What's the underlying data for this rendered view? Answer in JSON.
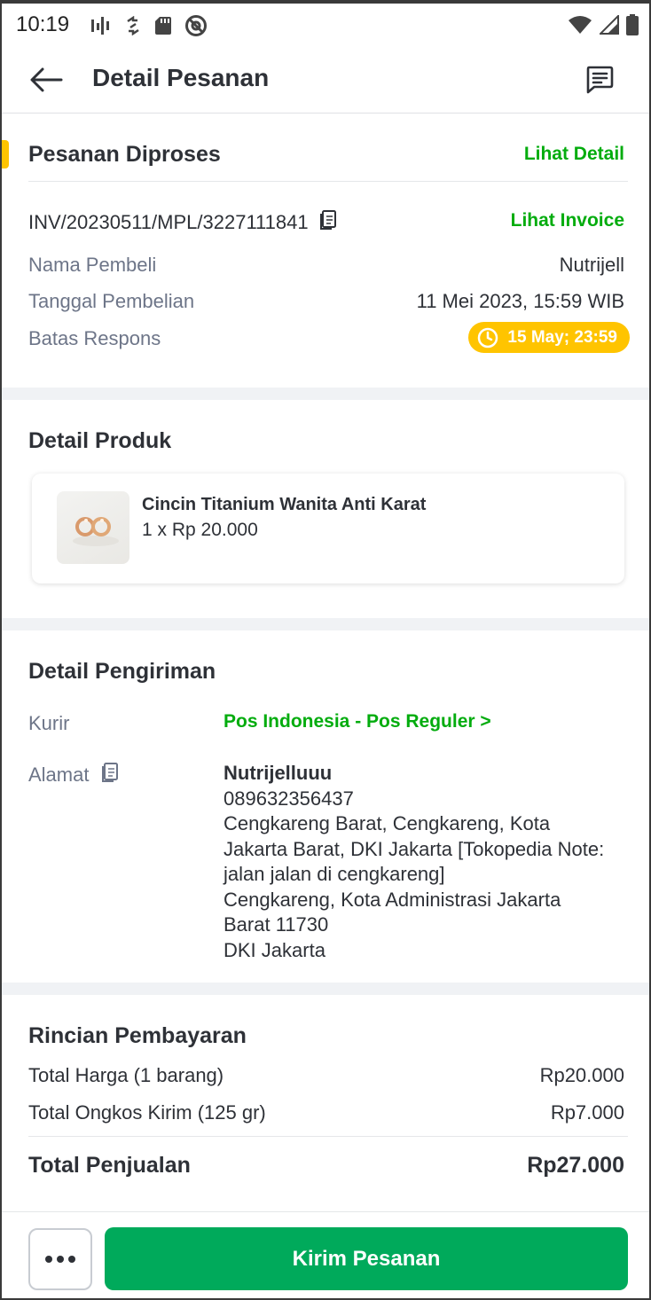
{
  "status_bar": {
    "time": "10:19"
  },
  "header": {
    "title": "Detail Pesanan",
    "back_icon": "arrow-left-icon",
    "chat_icon": "chat-list-icon"
  },
  "order_status": {
    "title": "Pesanan Diproses",
    "detail_link": "Lihat Detail",
    "invoice_number": "INV/20230511/MPL/3227111841",
    "invoice_link": "Lihat Invoice",
    "rows": [
      {
        "label": "Nama Pembeli",
        "value": "Nutrijell"
      },
      {
        "label": "Tanggal Pembelian",
        "value": "11 Mei 2023, 15:59 WIB"
      },
      {
        "label": "Batas Respons",
        "value": "15 May; 23:59"
      }
    ]
  },
  "product_section": {
    "title": "Detail Produk",
    "product": {
      "name": "Cincin Titanium Wanita Anti Karat",
      "quantity_price": "1 x Rp 20.000"
    }
  },
  "shipping_section": {
    "title": "Detail Pengiriman",
    "courier_label": "Kurir",
    "courier_value": "Pos Indonesia - Pos Reguler >",
    "address_label": "Alamat",
    "address": {
      "name": "Nutrijelluuu",
      "phone": "089632356437",
      "line1": "Cengkareng Barat, Cengkareng, Kota",
      "line2": "Jakarta Barat, DKI Jakarta [Tokopedia Note:",
      "line3": "jalan jalan di cengkareng]",
      "line4": "Cengkareng, Kota Administrasi Jakarta",
      "line5": "Barat 11730",
      "line6": "DKI Jakarta"
    }
  },
  "payment_section": {
    "title": "Rincian Pembayaran",
    "rows": [
      {
        "label": "Total Harga (1 barang)",
        "value": "Rp20.000"
      },
      {
        "label": "Total Ongkos Kirim (125 gr)",
        "value": "Rp7.000"
      }
    ],
    "total_label": "Total Penjualan",
    "total_value": "Rp27.000"
  },
  "bottom_bar": {
    "send_label": "Kirim Pesanan"
  },
  "colors": {
    "brand_green": "#03ac0e",
    "button_green": "#00aa5b",
    "accent_yellow": "#ffc400"
  }
}
